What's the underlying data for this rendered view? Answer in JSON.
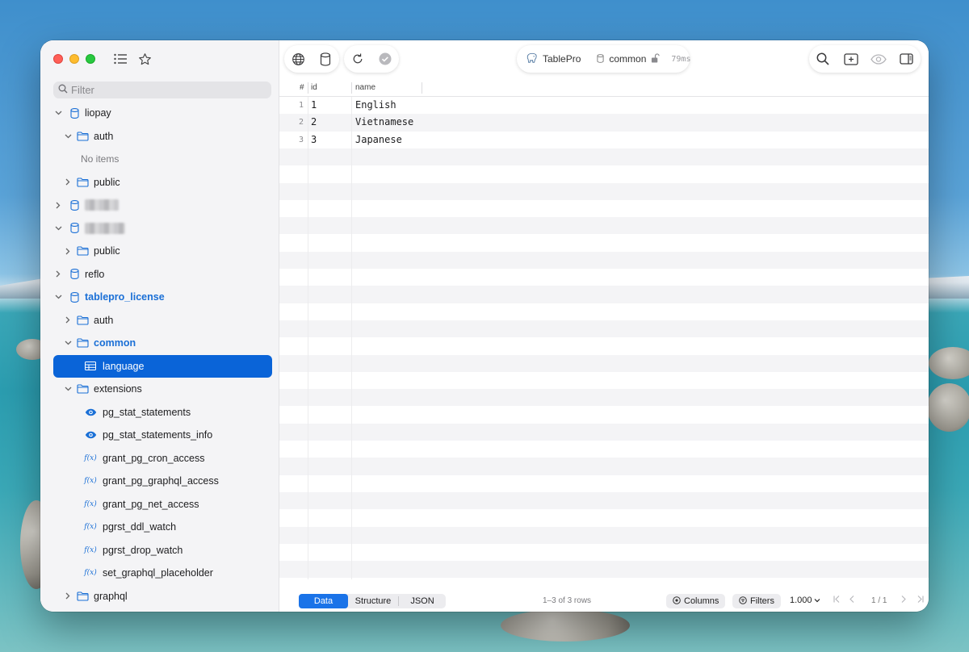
{
  "sidebar": {
    "filter_placeholder": "Filter",
    "tree": [
      {
        "label": "liopay",
        "type": "database",
        "depth": 0,
        "expanded": true
      },
      {
        "label": "auth",
        "type": "schema",
        "depth": 1,
        "expanded": true
      },
      {
        "label": "No items",
        "type": "empty",
        "depth": 2
      },
      {
        "label": "public",
        "type": "schema",
        "depth": 1,
        "expanded": false
      },
      {
        "label": "",
        "type": "database-redacted",
        "depth": 0,
        "expanded": false
      },
      {
        "label": "",
        "type": "database-redacted",
        "depth": 0,
        "expanded": true
      },
      {
        "label": "public",
        "type": "schema",
        "depth": 1,
        "expanded": false
      },
      {
        "label": "reflo",
        "type": "database",
        "depth": 0,
        "expanded": false
      },
      {
        "label": "tablepro_license",
        "type": "database",
        "depth": 0,
        "expanded": true,
        "active": true
      },
      {
        "label": "auth",
        "type": "schema",
        "depth": 1,
        "expanded": false
      },
      {
        "label": "common",
        "type": "schema",
        "depth": 1,
        "expanded": true,
        "active": true
      },
      {
        "label": "language",
        "type": "table",
        "depth": 2,
        "selected": true
      },
      {
        "label": "extensions",
        "type": "schema",
        "depth": 1,
        "expanded": true
      },
      {
        "label": "pg_stat_statements",
        "type": "view",
        "depth": 2
      },
      {
        "label": "pg_stat_statements_info",
        "type": "view",
        "depth": 2
      },
      {
        "label": "grant_pg_cron_access",
        "type": "function",
        "depth": 2
      },
      {
        "label": "grant_pg_graphql_access",
        "type": "function",
        "depth": 2
      },
      {
        "label": "grant_pg_net_access",
        "type": "function",
        "depth": 2
      },
      {
        "label": "pgrst_ddl_watch",
        "type": "function",
        "depth": 2
      },
      {
        "label": "pgrst_drop_watch",
        "type": "function",
        "depth": 2
      },
      {
        "label": "set_graphql_placeholder",
        "type": "function",
        "depth": 2
      },
      {
        "label": "graphql",
        "type": "schema",
        "depth": 1,
        "expanded": false
      }
    ],
    "fx_glyph": "f(x)"
  },
  "toolbar": {
    "app_name": "TablePro",
    "schema": "common",
    "latency": "79ms"
  },
  "grid": {
    "columns": [
      "#",
      "id",
      "name"
    ],
    "rows": [
      {
        "num": "1",
        "id": "1",
        "name": "English"
      },
      {
        "num": "2",
        "id": "2",
        "name": "Vietnamese"
      },
      {
        "num": "3",
        "id": "3",
        "name": "Japanese"
      }
    ]
  },
  "bottom": {
    "tabs": [
      "Data",
      "Structure",
      "JSON"
    ],
    "active_tab": "Data",
    "rows_info": "1–3 of 3 rows",
    "columns_label": "Columns",
    "filters_label": "Filters",
    "limit": "1.000",
    "page": "1 / 1"
  },
  "colors": {
    "accent": "#0a64d8",
    "link": "#1a6fd6"
  }
}
